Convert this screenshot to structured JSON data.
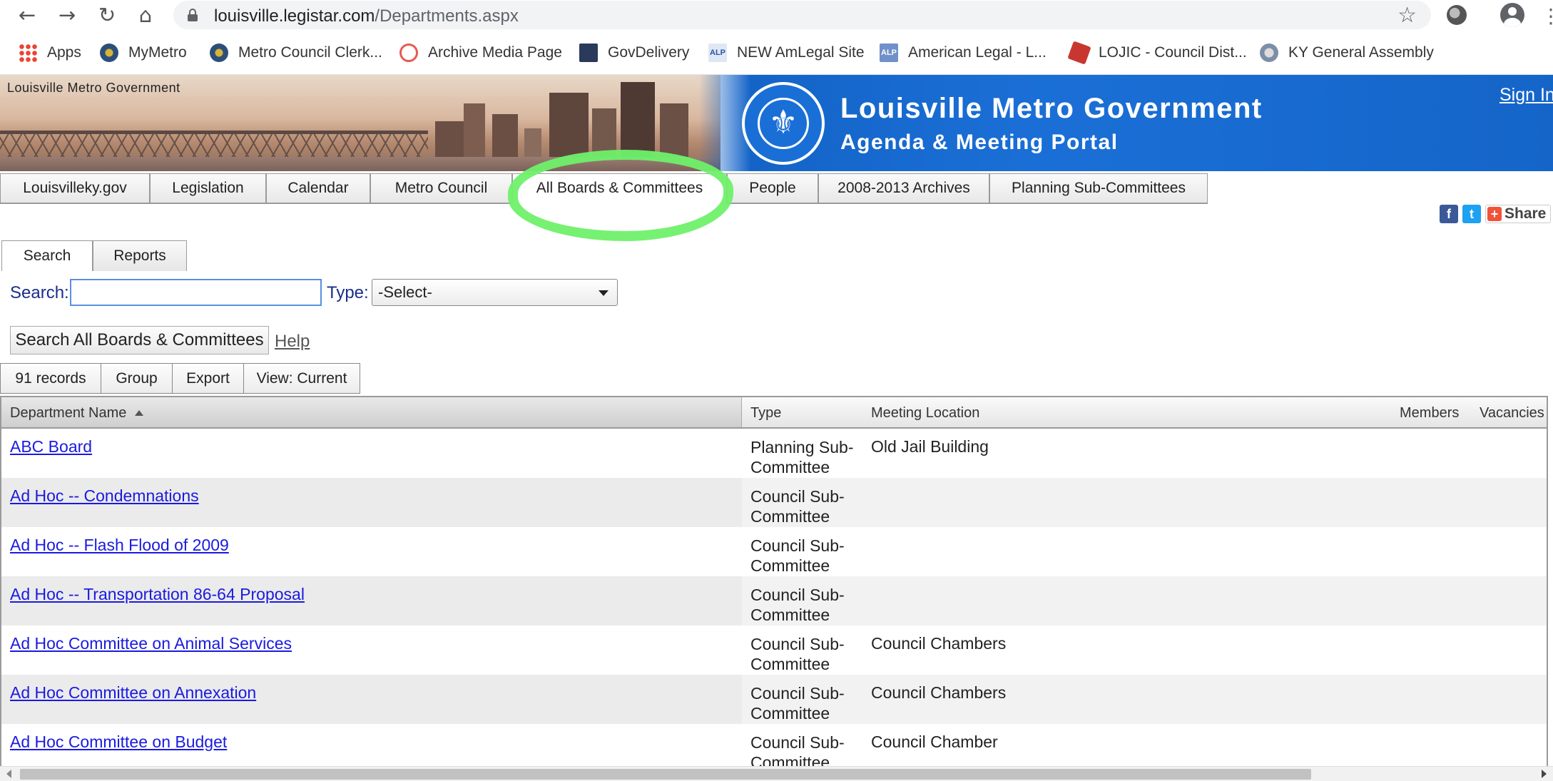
{
  "browser": {
    "url_host": "louisville.legistar.com",
    "url_path": "/Departments.aspx",
    "icons": [
      "back-icon",
      "forward-icon",
      "reload-icon",
      "home-icon",
      "lock-icon",
      "star-icon",
      "extension-icon",
      "profile-icon",
      "menu-icon"
    ]
  },
  "bookmarks": [
    {
      "label": "Apps"
    },
    {
      "label": "MyMetro"
    },
    {
      "label": "Metro Council Clerk..."
    },
    {
      "label": "Archive Media Page"
    },
    {
      "label": "GovDelivery"
    },
    {
      "label": "NEW AmLegal Site",
      "badge": "ALP"
    },
    {
      "label": "American Legal - L...",
      "badge": "ALP"
    },
    {
      "label": "LOJIC - Council Dist..."
    },
    {
      "label": "KY General Assembly"
    }
  ],
  "bookmarks_overflow": "x",
  "banner": {
    "site_label": "Louisville Metro Government",
    "title": "Louisville Metro Government",
    "subtitle": "Agenda & Meeting Portal",
    "sign_in": "Sign In"
  },
  "main_tabs": [
    {
      "label": "Louisvilleky.gov"
    },
    {
      "label": "Legislation"
    },
    {
      "label": "Calendar"
    },
    {
      "label": "Metro Council"
    },
    {
      "label": "All Boards & Committees",
      "active": true
    },
    {
      "label": "People"
    },
    {
      "label": "2008-2013 Archives"
    },
    {
      "label": "Planning Sub-Committees"
    }
  ],
  "share": {
    "fb": "f",
    "tw": "t",
    "label": "Share"
  },
  "sub_tabs": [
    {
      "label": "Search",
      "active": true
    },
    {
      "label": "Reports"
    }
  ],
  "search": {
    "search_label": "Search:",
    "search_value": "",
    "type_label": "Type:",
    "type_selected": "-Select-",
    "search_button": "Search All Boards & Committees",
    "help_link": "Help"
  },
  "grid_toolbar": {
    "records": "91 records",
    "group": "Group",
    "export": "Export",
    "view": "View: Current"
  },
  "grid": {
    "columns": {
      "name": "Department Name",
      "type": "Type",
      "location": "Meeting Location",
      "members": "Members",
      "vacancies": "Vacancies"
    },
    "rows": [
      {
        "name": "ABC Board",
        "type": "Planning Sub-Committee",
        "location": "Old Jail Building"
      },
      {
        "name": "Ad Hoc -- Condemnations",
        "type": "Council Sub-Committee",
        "location": ""
      },
      {
        "name": "Ad Hoc -- Flash Flood of 2009",
        "type": "Council Sub-Committee",
        "location": ""
      },
      {
        "name": "Ad Hoc -- Transportation 86-64 Proposal",
        "type": "Council Sub-Committee",
        "location": ""
      },
      {
        "name": "Ad Hoc Committee on Animal Services",
        "type": "Council Sub-Committee",
        "location": "Council Chambers"
      },
      {
        "name": "Ad Hoc Committee on Annexation",
        "type": "Council Sub-Committee",
        "location": "Council Chambers"
      },
      {
        "name": "Ad Hoc Committee on Budget",
        "type": "Council Sub-Committee",
        "location": "Council Chamber"
      }
    ]
  },
  "colors": {
    "banner_blue": "#1a6fd6",
    "link_blue": "#1a1ae0",
    "label_navy": "#1a2d8a",
    "highlight_green": "#6ff06a"
  }
}
